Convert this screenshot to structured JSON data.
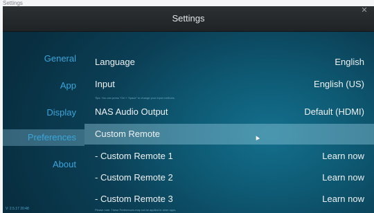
{
  "window": {
    "label": "Settings"
  },
  "header": {
    "title": "Settings"
  },
  "sidebar": {
    "items": [
      {
        "label": "General"
      },
      {
        "label": "App"
      },
      {
        "label": "Display"
      },
      {
        "label": "Preferences"
      },
      {
        "label": "About"
      }
    ],
    "version": "V: 2.5.17 20:48"
  },
  "settings": {
    "rows": [
      {
        "label": "Language",
        "value": "English"
      },
      {
        "label": "Input",
        "value": "English (US)"
      },
      {
        "label": "NAS Audio Output",
        "value": "Default (HDMI)"
      },
      {
        "label": "Custom Remote",
        "value": ""
      },
      {
        "label": "- Custom Remote 1",
        "value": "Learn now"
      },
      {
        "label": "- Custom Remote 2",
        "value": "Learn now"
      },
      {
        "label": "- Custom Remote 3",
        "value": "Learn now"
      }
    ],
    "input_hint": "Tips: You can press \"Ctrl + Space\" to change your input methods.",
    "footer_note": "Please note: These Preferences may not be applied in other apps."
  },
  "colors": {
    "accent": "#3aa6dc",
    "titlebar": "#2a2e31",
    "highlight": "#8cc8e1"
  }
}
